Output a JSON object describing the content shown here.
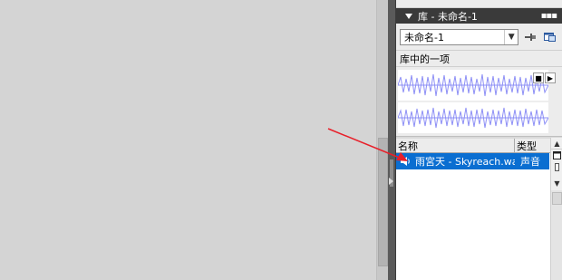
{
  "library_panel": {
    "title": "库 - 未命名-1",
    "document_select": {
      "value": "未命名-1"
    },
    "preview_label": "库中的一项",
    "list": {
      "columns": [
        "名称",
        "类型"
      ],
      "items": [
        {
          "name": "雨宮天 - Skyreach.wav",
          "type": "声音",
          "icon": "speaker-icon",
          "selected": true
        }
      ]
    }
  },
  "colors": {
    "selection": "#0a6ed1",
    "waveform": "#8e90f6",
    "panel_title_bar": "#3a3a3a",
    "annotation_arrow": "#e8202a"
  }
}
